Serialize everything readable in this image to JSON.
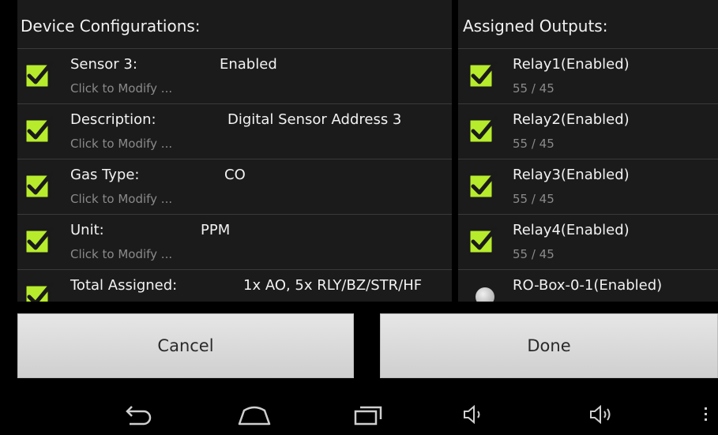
{
  "left_panel": {
    "title": "Device Configurations:",
    "rows": [
      {
        "label": "Sensor 3:",
        "value": "Enabled",
        "sub": "Click to Modify ...",
        "checked": true
      },
      {
        "label": "Description:",
        "value": "Digital Sensor Address 3",
        "sub": "Click to Modify ...",
        "checked": true
      },
      {
        "label": "Gas Type:",
        "value": "CO",
        "sub": "Click to Modify ...",
        "checked": true
      },
      {
        "label": "Unit:",
        "value": "PPM",
        "sub": "Click to Modify ...",
        "checked": true
      },
      {
        "label": "Total Assigned:",
        "value": "1x AO, 5x RLY/BZ/STR/HF",
        "checked": true
      }
    ]
  },
  "right_panel": {
    "title": "Assigned Outputs:",
    "rows": [
      {
        "label": "Relay1(Enabled)",
        "sub": "55 / 45",
        "checked": true
      },
      {
        "label": "Relay2(Enabled)",
        "sub": "55 / 45",
        "checked": true
      },
      {
        "label": "Relay3(Enabled)",
        "sub": "55 / 45",
        "checked": true
      },
      {
        "label": "Relay4(Enabled)",
        "sub": "55 / 45",
        "checked": true
      },
      {
        "label": "RO-Box-0-1(Enabled)",
        "selected": true
      }
    ]
  },
  "buttons": {
    "cancel": "Cancel",
    "done": "Done"
  },
  "navbar": {
    "icons": [
      "back-icon",
      "home-icon",
      "recent-apps-icon",
      "volume-down-icon",
      "volume-up-icon",
      "overflow-menu-icon"
    ]
  },
  "colors": {
    "checkbox_fill": "#b7ec2c",
    "checkmark": "#1a1a1a",
    "panel_bg": "#1b1b1b",
    "divider": "#3a3a3a",
    "subtext": "#8a8a8a",
    "button_bg": "#dcdcdc"
  }
}
